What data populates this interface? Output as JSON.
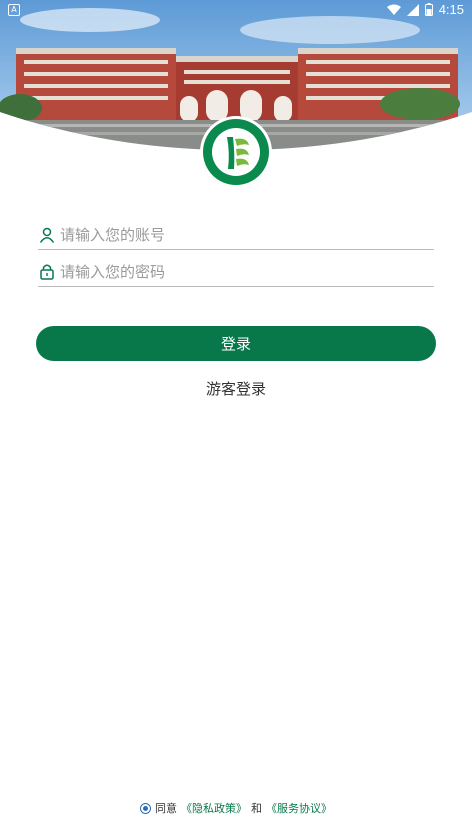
{
  "status_bar": {
    "time": "4:15",
    "notification_icon": "a-square-icon",
    "icons": [
      "wifi-icon",
      "signal-icon",
      "battery-icon"
    ]
  },
  "header": {
    "banner_image": "campus-building-photo",
    "logo": "school-emblem-logo"
  },
  "form": {
    "account_placeholder": "请输入您的账号",
    "password_placeholder": "请输入您的密码",
    "account_icon": "user-icon",
    "password_icon": "lock-icon"
  },
  "buttons": {
    "login": "登录",
    "guest_login": "游客登录"
  },
  "agreement": {
    "agree_text": "同意",
    "privacy_link": "《隐私政策》",
    "and_text": "和",
    "service_link": "《服务协议》"
  },
  "colors": {
    "primary": "#08784b",
    "radio": "#2e6db5",
    "placeholder": "#9a9a9a"
  }
}
